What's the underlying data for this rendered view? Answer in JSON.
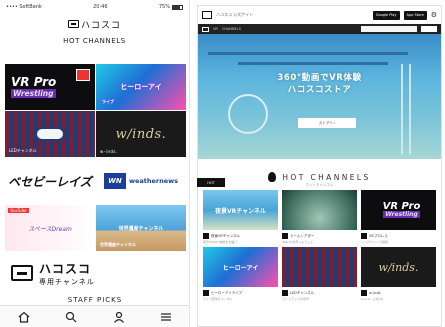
{
  "phone": {
    "status": {
      "carrier": "•••• SoftBank",
      "time": "20:46",
      "battery": "75%"
    },
    "logo_text": "ハコスコ",
    "section_title": "HOT CHANNELS",
    "tiles": [
      {
        "line1": "VR Pro",
        "line2": "Wrestling"
      },
      {
        "title": "ヒーローアイ",
        "sub": "ライブ"
      },
      {
        "caption": "LEDチャンネル"
      },
      {
        "title": "w/inds.",
        "caption": "w-inds."
      },
      {
        "title": "ベセビーレイズ"
      },
      {
        "mark": "WN",
        "title": "weathernews"
      },
      {
        "tag": "YouTube",
        "title": "スペースDream"
      },
      {
        "title": "世界遺産チャンネル",
        "caption": "世界遺産チャンネル"
      }
    ],
    "banner": {
      "title": "ハコスコ",
      "subtitle": "専用チャンネル"
    },
    "staff_title": "STAFF PICKS",
    "tabs": [
      "home-icon",
      "search-icon",
      "user-icon",
      "menu-icon"
    ]
  },
  "web": {
    "site_name": "ハコスコ 公式サイト",
    "store_google": "Google Play",
    "store_apple": "App Store",
    "nav": {
      "item1": "VR",
      "item2": "CHANNELS"
    },
    "hero": {
      "line1": "360°動画でVR体験",
      "line2": "ハコスコストア",
      "button": "ストアへ ›"
    },
    "section_title": "HOT CHANNELS",
    "section_sub": "ホットチャンネル",
    "tab_label": "HOT",
    "cards": [
      {
        "thumb_text": "夜景VRチャンネル",
        "name": "夜景VRチャンネル",
        "desc": "夜景の360°映像をお届け"
      },
      {
        "thumb_text": "",
        "name": "ドームシアター",
        "desc": "360°の世界へようこそ"
      },
      {
        "line1": "VR Pro",
        "line2": "Wrestling",
        "name": "VRプロレス",
        "desc": "リングサイドで観戦"
      },
      {
        "thumb_text": "ヒーローアイ",
        "name": "ヒーローアイライブ",
        "desc": "ライブ配信チャンネル"
      },
      {
        "thumb_text": "",
        "name": "LEDチャンネル",
        "desc": "ライトアップの世界"
      },
      {
        "thumb_text": "w/inds.",
        "name": "w-inds.",
        "desc": "w-inds. 公式VR"
      }
    ]
  }
}
